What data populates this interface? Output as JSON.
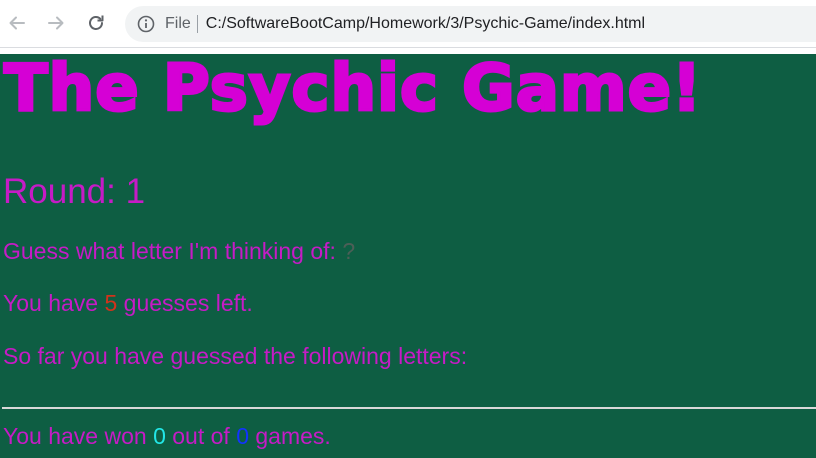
{
  "browser": {
    "file_label": "File",
    "url": "C:/SoftwareBootCamp/Homework/3/Psychic-Game/index.html"
  },
  "game": {
    "title": "The Psychic Game!",
    "round_label": "Round: ",
    "round_value": "1",
    "guess_prompt": "Guess what letter I'm thinking of: ",
    "mystery_letter": "?",
    "guesses_prefix": "You have ",
    "guesses_left": "5",
    "guesses_suffix": " guesses left.",
    "guessed_label": "So far you have guessed the following letters:",
    "guessed_letters": "",
    "won_prefix": "You have won ",
    "wins": "0",
    "won_middle": " out of ",
    "games": "0",
    "won_suffix": " games."
  },
  "colors": {
    "background": "#0e5e43",
    "title": "#d500d5",
    "text": "#c61bc6",
    "guesses_left": "#d0331b",
    "wins": "#22e6e6",
    "games": "#1233ff"
  }
}
